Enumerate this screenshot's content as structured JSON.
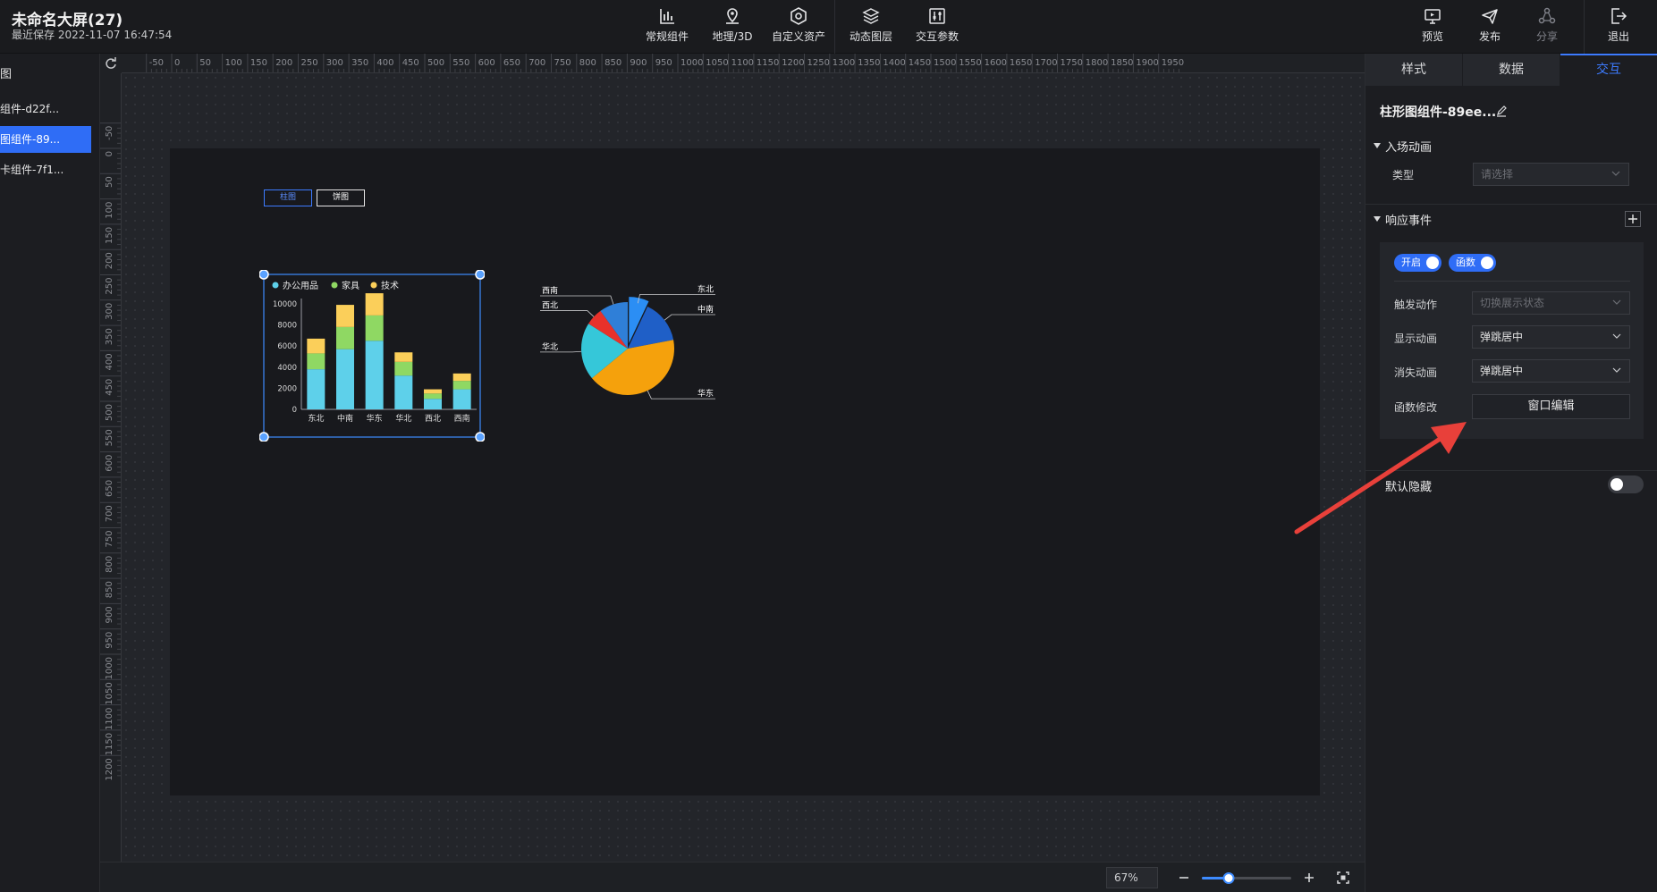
{
  "header": {
    "title": "未命名大屏(27)",
    "save_time": "最近保存 2022-11-07 16:47:54",
    "tools": {
      "common": "常规组件",
      "geo": "地理/3D",
      "custom": "自定义资产",
      "layers": "动态图层",
      "params": "交互参数"
    },
    "actions": {
      "preview": "预览",
      "publish": "发布",
      "share": "分享",
      "exit": "退出"
    }
  },
  "left_panel": {
    "head": "图",
    "layers": [
      "组件-d22f...",
      "图组件-89...",
      "卡组件-7f1..."
    ],
    "active_index": 1
  },
  "canvas": {
    "tabs": {
      "bar": "柱图",
      "pie": "饼图"
    },
    "zoom": "67%",
    "zoom_fraction": 0.3
  },
  "chart_data": [
    {
      "type": "bar",
      "stacked": true,
      "categories": [
        "东北",
        "中南",
        "华东",
        "华北",
        "西北",
        "西南"
      ],
      "series": [
        {
          "name": "办公用品",
          "values": [
            3800,
            5700,
            6500,
            3200,
            1000,
            1900
          ],
          "color": "#5ed0ea"
        },
        {
          "name": "家具",
          "values": [
            1500,
            2100,
            2400,
            1300,
            500,
            800
          ],
          "color": "#8fd863"
        },
        {
          "name": "技术",
          "values": [
            1400,
            2100,
            2100,
            900,
            400,
            700
          ],
          "color": "#fbcf5a"
        }
      ],
      "yticks": [
        "10000",
        "8000",
        "6000",
        "4000",
        "2000",
        "0"
      ],
      "ylim": [
        0,
        10500
      ],
      "legend": "top-left"
    },
    {
      "type": "pie",
      "labels": [
        "东北",
        "中南",
        "华东",
        "华北",
        "西北",
        "西南"
      ],
      "values": [
        7,
        15,
        42,
        20,
        6,
        10
      ],
      "colors": [
        "#2b8ef4",
        "#1f5fc7",
        "#f5a10c",
        "#35c7d9",
        "#e8312a",
        "#2f7fd8"
      ]
    }
  ],
  "right_panel": {
    "tabs": [
      "样式",
      "数据",
      "交互"
    ],
    "active_tab": 2,
    "component_title": "柱形图组件-89ee...",
    "entry_anim": {
      "title": "入场动画",
      "type_label": "类型",
      "type_placeholder": "请选择"
    },
    "events": {
      "title": "响应事件",
      "toggle_on": "开启",
      "toggle_func": "函数",
      "trigger_label": "触发动作",
      "trigger_value": "切换展示状态",
      "show_label": "显示动画",
      "show_value": "弹跳居中",
      "hide_label": "消失动画",
      "hide_value": "弹跳居中",
      "func_label": "函数修改",
      "func_button": "窗口编辑"
    },
    "default_hidden": "默认隐藏"
  },
  "colors": {
    "accent": "#2f6df6",
    "annotation_arrow": "#e8403a"
  }
}
